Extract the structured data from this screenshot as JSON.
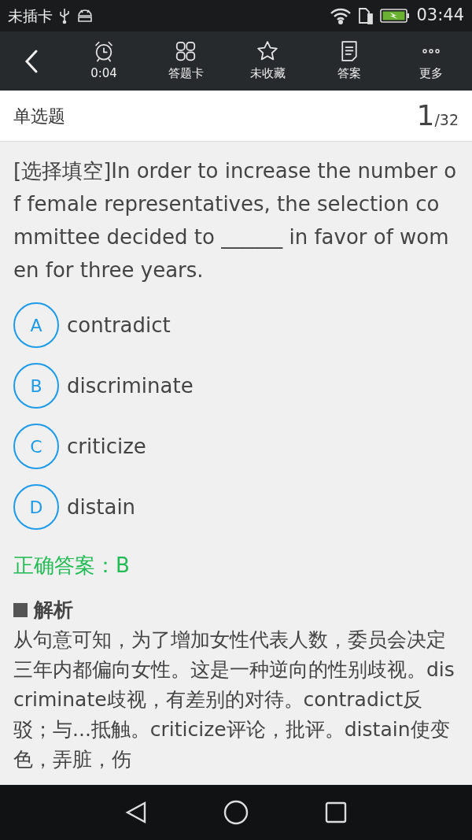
{
  "status_bar": {
    "carrier": "未插卡",
    "time": "03:44"
  },
  "toolbar": {
    "items": [
      {
        "kind": "timer",
        "label": "0:04"
      },
      {
        "kind": "grid",
        "label": "答题卡"
      },
      {
        "kind": "star",
        "label": "未收藏"
      },
      {
        "kind": "document",
        "label": "答案"
      },
      {
        "kind": "more",
        "label": "更多"
      }
    ]
  },
  "header": {
    "title": "单选题",
    "current": "1",
    "total": "/32"
  },
  "question": "[选择填空]In order to increase the number of female representatives, the selection committee decided to ______ in favor of women for three years.",
  "options": [
    {
      "letter": "A",
      "text": "contradict"
    },
    {
      "letter": "B",
      "text": "discriminate"
    },
    {
      "letter": "C",
      "text": "criticize"
    },
    {
      "letter": "D",
      "text": "distain"
    }
  ],
  "answer": "正确答案：B",
  "analysis": {
    "title": "解析",
    "text": "从句意可知，为了增加女性代表人数，委员会决定三年内都偏向女性。这是一种逆向的性别歧视。discriminate歧视，有差别的对待。contradict反驳；与...抵触。criticize评论，批评。distain使变色，弄脏，伤"
  }
}
